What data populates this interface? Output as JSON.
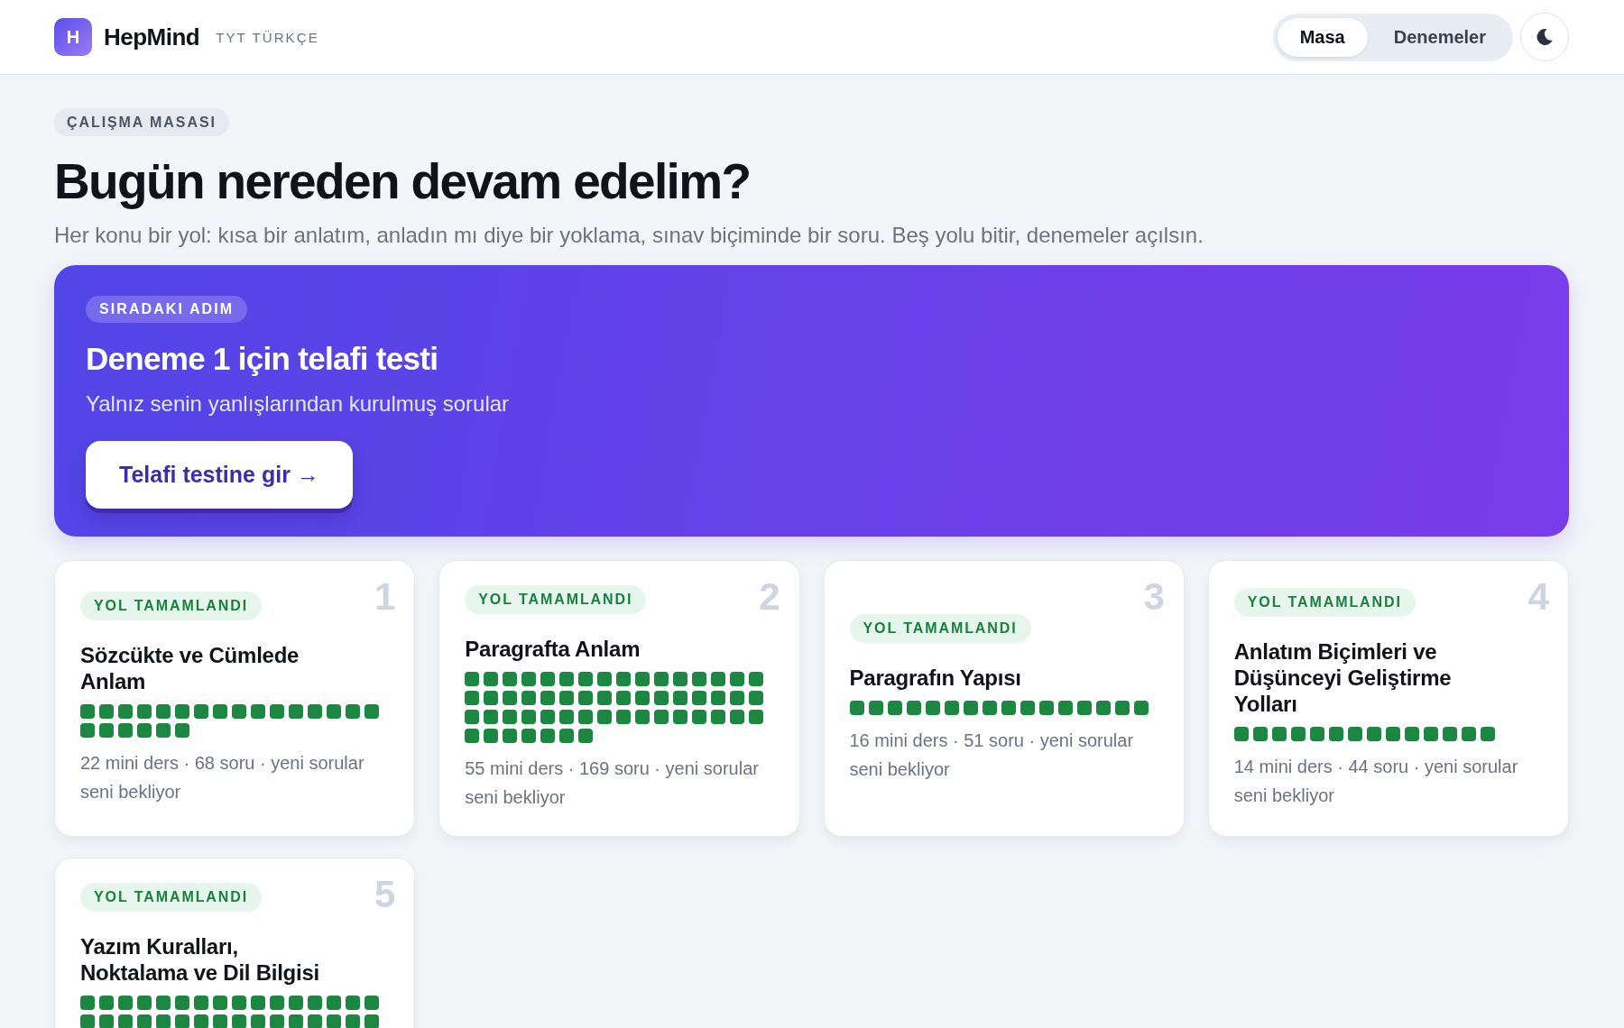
{
  "header": {
    "logo_letter": "H",
    "brand": "HepMind",
    "subtitle": "TYT TÜRKÇE",
    "tabs": [
      {
        "label": "Masa",
        "selected": true
      },
      {
        "label": "Denemeler",
        "selected": false
      }
    ]
  },
  "intro": {
    "eyebrow": "ÇALIŞMA MASASI",
    "title": "Bugün nereden devam edelim?",
    "description": "Her konu bir yol: kısa bir anlatım, anladın mı diye bir yoklama, sınav biçiminde bir soru. Beş yolu bitir, denemeler açılsın."
  },
  "next_step": {
    "badge": "SIRADAKI ADIM",
    "title": "Deneme 1 için telafi testi",
    "description": "Yalnız senin yanlışlarından kurulmuş sorular",
    "button": "Telafi testine gir →"
  },
  "paths": [
    {
      "number": "1",
      "badge": "YOL TAMAMLANDI",
      "title": "Sözcükte ve Cümlede Anlam",
      "lessons": [
        true,
        true,
        true,
        true,
        true,
        true,
        true,
        true,
        true,
        true,
        true,
        true,
        true,
        true,
        true,
        true,
        true,
        true,
        true,
        true,
        true,
        true
      ],
      "meta": "22 mini ders · 68 soru · yeni sorular seni bekliyor"
    },
    {
      "number": "2",
      "badge": "YOL TAMAMLANDI",
      "title": "Paragrafta Anlam",
      "lessons": [
        true,
        true,
        true,
        true,
        true,
        true,
        true,
        true,
        true,
        true,
        true,
        true,
        true,
        true,
        true,
        true,
        true,
        true,
        true,
        true,
        true,
        true,
        true,
        true,
        true,
        true,
        true,
        true,
        true,
        true,
        true,
        true,
        true,
        true,
        true,
        true,
        true,
        true,
        true,
        true,
        true,
        true,
        true,
        true,
        true,
        true,
        true,
        true,
        true,
        true,
        true,
        true,
        true,
        true,
        true
      ],
      "meta": "55 mini ders · 169 soru · yeni sorular seni bekliyor"
    },
    {
      "number": "3",
      "badge": "YOL TAMAMLANDI",
      "title": "Paragrafın Yapısı",
      "lessons": [
        true,
        true,
        true,
        true,
        true,
        true,
        true,
        true,
        true,
        true,
        true,
        true,
        true,
        true,
        true,
        true
      ],
      "meta": "16 mini ders · 51 soru · yeni sorular seni bekliyor"
    },
    {
      "number": "4",
      "badge": "YOL TAMAMLANDI",
      "title": "Anlatım Biçimleri ve Düşünceyi Geliştirme Yolları",
      "lessons": [
        true,
        true,
        true,
        true,
        true,
        true,
        true,
        true,
        true,
        true,
        true,
        true,
        true,
        true
      ],
      "meta": "14 mini ders · 44 soru · yeni sorular seni bekliyor"
    },
    {
      "number": "5",
      "badge": "YOL TAMAMLANDI",
      "title": "Yazım Kuralları, Noktalama ve Dil Bilgisi",
      "lessons": [
        true,
        true,
        true,
        true,
        true,
        true,
        true,
        true,
        true,
        true,
        true,
        true,
        true,
        true,
        true,
        true,
        true,
        true,
        true,
        true,
        true,
        true,
        true,
        true,
        true,
        true,
        true,
        true,
        true,
        true,
        true,
        true
      ]
    }
  ]
}
